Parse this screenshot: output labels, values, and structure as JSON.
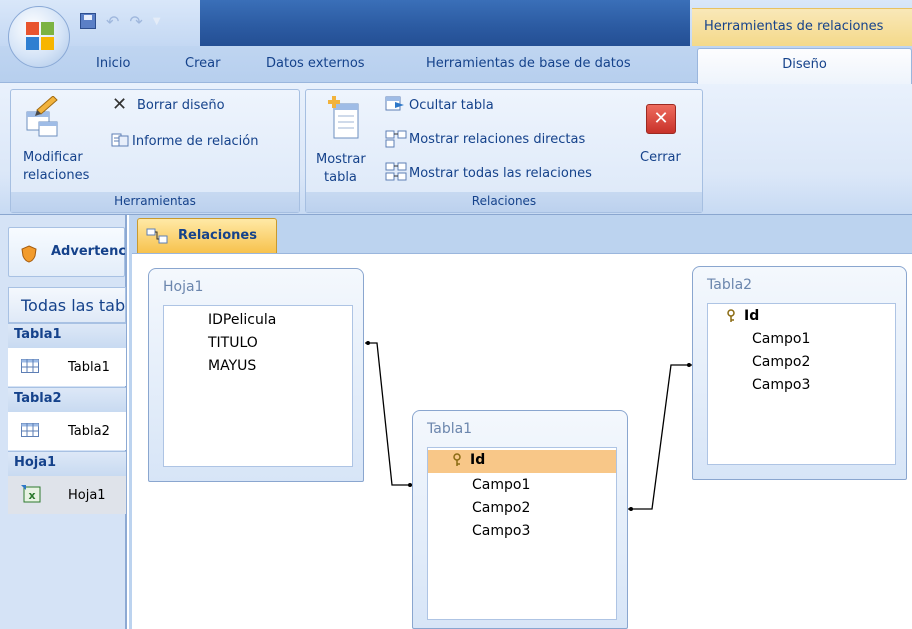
{
  "title_bar": {
    "context_tab_header": "Herramientas de relaciones"
  },
  "tabs": [
    "Inicio",
    "Crear",
    "Datos externos",
    "Herramientas de base de datos"
  ],
  "active_tab": "Diseño",
  "ribbon": {
    "herramientas": {
      "label": "Herramientas",
      "modificar_line1": "Modificar",
      "modificar_line2": "relaciones",
      "borrar": "Borrar diseño",
      "informe": "Informe de relación"
    },
    "relaciones": {
      "label": "Relaciones",
      "mostrar_line1": "Mostrar",
      "mostrar_line2": "tabla",
      "ocultar": "Ocultar tabla",
      "directas": "Mostrar relaciones directas",
      "todas": "Mostrar todas las relaciones",
      "cerrar": "Cerrar"
    }
  },
  "nav": {
    "warning": "Advertencia",
    "header": "Todas las tablas",
    "groups": [
      {
        "title": "Tabla1",
        "item": "Tabla1"
      },
      {
        "title": "Tabla2",
        "item": "Tabla2"
      },
      {
        "title": "Hoja1",
        "item": "Hoja1"
      }
    ]
  },
  "document_tab": "Relaciones",
  "tables": {
    "hoja1": {
      "title": "Hoja1",
      "fields": [
        "IDPelicula",
        "TITULO",
        "MAYUS"
      ]
    },
    "tabla1": {
      "title": "Tabla1",
      "fields": [
        "Id",
        "Campo1",
        "Campo2",
        "Campo3"
      ],
      "key": "Id",
      "highlighted": "Id"
    },
    "tabla2": {
      "title": "Tabla2",
      "fields": [
        "Id",
        "Campo1",
        "Campo2",
        "Campo3"
      ],
      "key": "Id"
    }
  },
  "colors": {
    "accent_text": "#15428b",
    "highlight_field": "#f8c788",
    "close_button": "#d9433b",
    "doc_tab": "#f7c24d"
  }
}
